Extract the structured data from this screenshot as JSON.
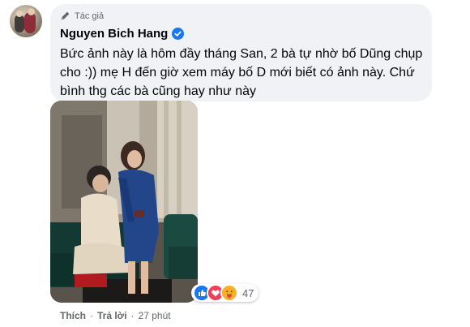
{
  "comment": {
    "role_badge": "Tác giả",
    "author": "Nguyen Bich Hang",
    "text": "Bức ảnh này là hôm đầy tháng San, 2 bà tự nhờ bố Dũng chụp cho :)) mẹ H đến giờ xem máy bố D mới biết có ảnh này. Chứ bình thg các bà cũng hay như này"
  },
  "reactions": {
    "icons": [
      "like-icon",
      "love-icon",
      "care-icon"
    ],
    "count": "47"
  },
  "actions": {
    "like_label": "Thích",
    "reply_label": "Trả lời",
    "separator": "·",
    "timestamp": "27 phút"
  },
  "colors": {
    "bubble_bg": "#f0f2f5",
    "verified_blue": "#1877f2",
    "meta_text": "#65676b"
  }
}
